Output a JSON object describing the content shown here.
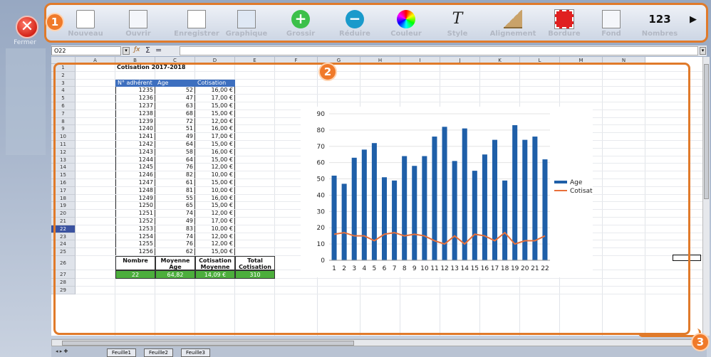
{
  "sidebar": {
    "close_label": "Fermer",
    "close_glyph": "✕"
  },
  "toolbar": {
    "badge": "1",
    "buttons": [
      {
        "label": "Nouveau",
        "icon": "new-document-icon"
      },
      {
        "label": "Ouvrir",
        "icon": "open-folder-icon"
      },
      {
        "label": "Enregistrer",
        "icon": "save-icon"
      },
      {
        "label": "Graphique",
        "icon": "chart-icon"
      },
      {
        "label": "Grossir",
        "icon": "zoom-in-icon"
      },
      {
        "label": "Réduire",
        "icon": "zoom-out-icon"
      },
      {
        "label": "Couleur",
        "icon": "color-wheel-icon"
      },
      {
        "label": "Style",
        "icon": "text-style-icon"
      },
      {
        "label": "Alignement",
        "icon": "alignment-icon"
      },
      {
        "label": "Bordure",
        "icon": "border-icon"
      },
      {
        "label": "Fond",
        "icon": "fill-icon"
      },
      {
        "label": "Nombres",
        "icon": "numbers-icon"
      }
    ],
    "numbers_glyph": "123",
    "more_glyph": "▶"
  },
  "formula": {
    "cell_ref": "O22",
    "sum_glyph": "Σ",
    "eq_glyph": "=",
    "fx_glyph": "ƒx",
    "value": ""
  },
  "sheet": {
    "badge": "2",
    "columns": [
      "A",
      "B",
      "C",
      "D",
      "E",
      "F",
      "G",
      "H",
      "I",
      "J",
      "K",
      "L",
      "M",
      "N"
    ],
    "rows": [
      "1",
      "2",
      "3",
      "4",
      "5",
      "6",
      "7",
      "8",
      "9",
      "10",
      "11",
      "12",
      "13",
      "14",
      "15",
      "16",
      "17",
      "18",
      "19",
      "20",
      "21",
      "22",
      "23",
      "24",
      "25",
      "26",
      "27",
      "28",
      "29"
    ],
    "selected_row": "22",
    "title": "Cotisation 2017-2018",
    "headers": [
      "N° adhérent",
      "Age",
      "Cotisation"
    ],
    "records": [
      [
        "1235",
        "52",
        "16,00 €"
      ],
      [
        "1236",
        "47",
        "17,00 €"
      ],
      [
        "1237",
        "63",
        "15,00 €"
      ],
      [
        "1238",
        "68",
        "15,00 €"
      ],
      [
        "1239",
        "72",
        "12,00 €"
      ],
      [
        "1240",
        "51",
        "16,00 €"
      ],
      [
        "1241",
        "49",
        "17,00 €"
      ],
      [
        "1242",
        "64",
        "15,00 €"
      ],
      [
        "1243",
        "58",
        "16,00 €"
      ],
      [
        "1244",
        "64",
        "15,00 €"
      ],
      [
        "1245",
        "76",
        "12,00 €"
      ],
      [
        "1246",
        "82",
        "10,00 €"
      ],
      [
        "1247",
        "61",
        "15,00 €"
      ],
      [
        "1248",
        "81",
        "10,00 €"
      ],
      [
        "1249",
        "55",
        "16,00 €"
      ],
      [
        "1250",
        "65",
        "15,00 €"
      ],
      [
        "1251",
        "74",
        "12,00 €"
      ],
      [
        "1252",
        "49",
        "17,00 €"
      ],
      [
        "1253",
        "83",
        "10,00 €"
      ],
      [
        "1254",
        "74",
        "12,00 €"
      ],
      [
        "1255",
        "76",
        "12,00 €"
      ],
      [
        "1256",
        "62",
        "15,00 €"
      ]
    ],
    "summary_headers": [
      "Nombre",
      "Moyenne Age",
      "Cotisation Moyenne",
      "Total Cotisation"
    ],
    "summary_values": [
      "22",
      "64,82",
      "14,09 €",
      "310"
    ],
    "tabs": [
      "Feuille1",
      "Feuille2",
      "Feuille3"
    ],
    "scroll_badge": "3"
  },
  "colors": {
    "accent_orange": "#e07a2a",
    "header_blue": "#3d6fbf",
    "summary_green": "#4cae3c",
    "bar_blue": "#1f5fa8",
    "line_orange": "#e8703a"
  },
  "chart_data": {
    "type": "bar",
    "categories": [
      "1",
      "2",
      "3",
      "4",
      "5",
      "6",
      "7",
      "8",
      "9",
      "10",
      "11",
      "12",
      "13",
      "14",
      "15",
      "16",
      "17",
      "18",
      "19",
      "20",
      "21",
      "22"
    ],
    "series": [
      {
        "name": "Age",
        "type": "bar",
        "values": [
          52,
          47,
          63,
          68,
          72,
          51,
          49,
          64,
          58,
          64,
          76,
          82,
          61,
          81,
          55,
          65,
          74,
          49,
          83,
          74,
          76,
          62
        ]
      },
      {
        "name": "Cotisation",
        "type": "line",
        "values": [
          16,
          17,
          15,
          15,
          12,
          16,
          17,
          15,
          16,
          15,
          12,
          10,
          15,
          10,
          16,
          15,
          12,
          17,
          10,
          12,
          12,
          15
        ]
      }
    ],
    "yticks": [
      "0",
      "10",
      "20",
      "30",
      "40",
      "50",
      "60",
      "70",
      "80",
      "90"
    ],
    "ylim": [
      0,
      90
    ],
    "grid": true,
    "legend": "right"
  }
}
